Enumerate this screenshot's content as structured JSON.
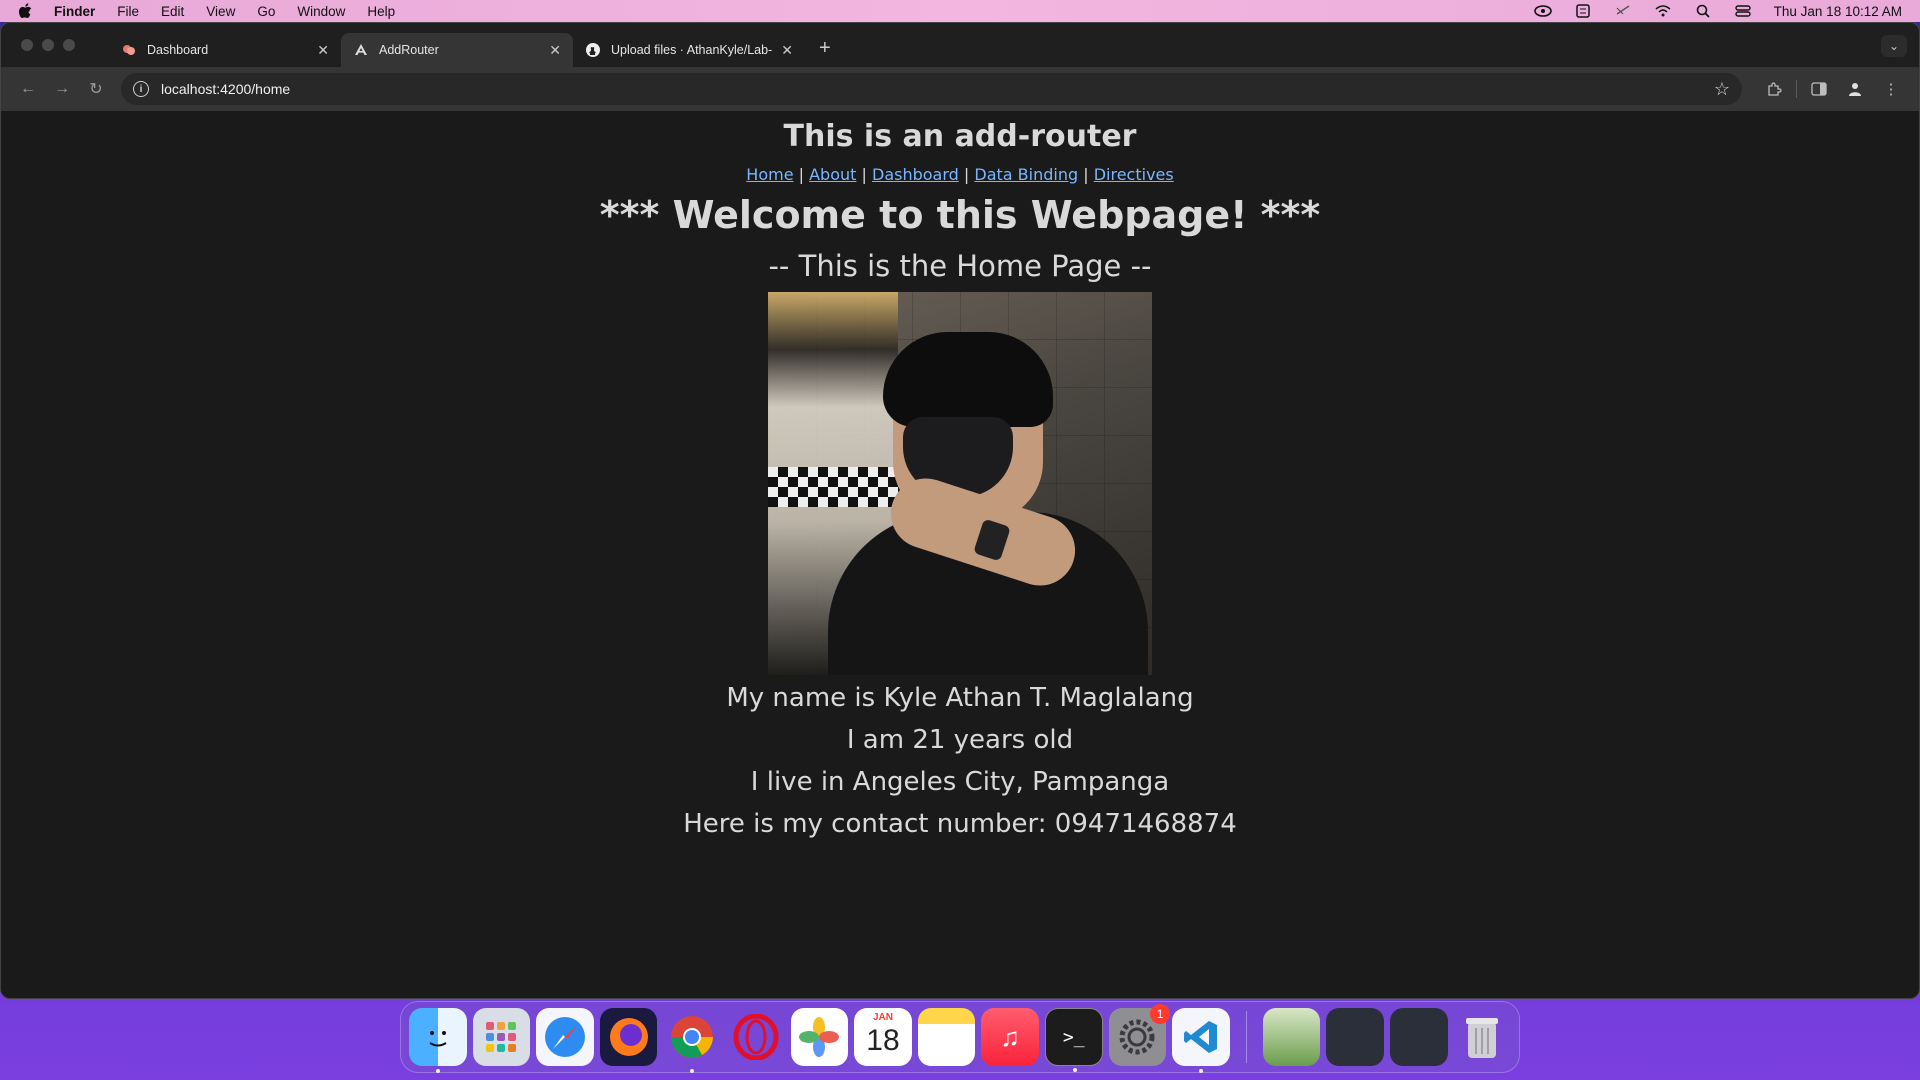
{
  "menubar": {
    "app_name": "Finder",
    "items": [
      "File",
      "Edit",
      "View",
      "Go",
      "Window",
      "Help"
    ],
    "datetime": "Thu Jan 18  10:12 AM"
  },
  "tabs": [
    {
      "title": "Dashboard",
      "favicon": "dashboard-favicon",
      "active": false
    },
    {
      "title": "AddRouter",
      "favicon": "angular-favicon",
      "active": true
    },
    {
      "title": "Upload files · AthanKyle/Lab-",
      "favicon": "github-favicon",
      "active": false
    }
  ],
  "toolbar": {
    "url": "localhost:4200/home"
  },
  "page": {
    "title": "This is an add-router",
    "nav_links": [
      "Home",
      "About",
      "Dashboard",
      "Data Binding",
      "Directives"
    ],
    "welcome": "*** Welcome to this Webpage! ***",
    "subheading": "-- This is the Home Page --",
    "info_lines": [
      "My name is Kyle Athan T. Maglalang",
      "I am 21 years old",
      "I live in Angeles City, Pampanga",
      "Here is my contact number: 09471468874"
    ]
  },
  "dock": {
    "calendar_month": "JAN",
    "calendar_day": "18",
    "settings_badge": "1",
    "apps": [
      "finder-icon",
      "launchpad-icon",
      "safari-icon",
      "firefox-icon",
      "chrome-icon",
      "opera-icon",
      "photos-icon",
      "calendar-icon",
      "notes-icon",
      "music-icon",
      "terminal-icon",
      "system-settings-icon",
      "vscode-icon"
    ]
  }
}
